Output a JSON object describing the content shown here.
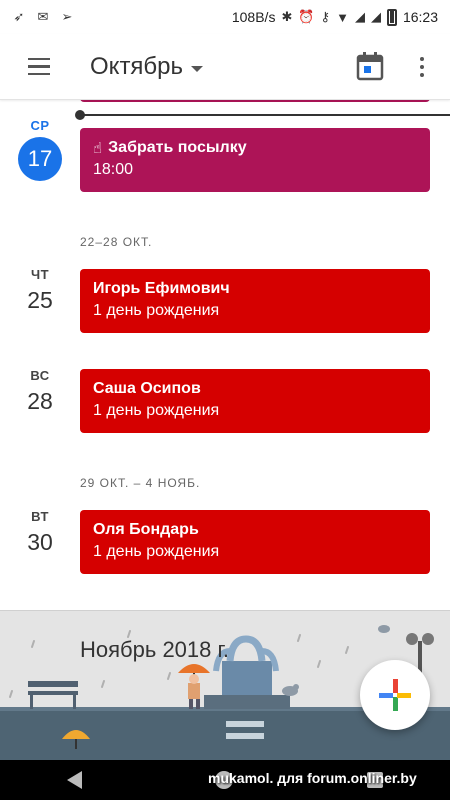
{
  "status_bar": {
    "speed": "108B/s",
    "time": "16:23"
  },
  "app_bar": {
    "month": "Октябрь"
  },
  "schedule": {
    "days": [
      {
        "dow": "СР",
        "num": "17",
        "today": true,
        "event": {
          "title": "Забрать посылку",
          "subtitle": "18:00"
        }
      },
      {
        "dow": "ЧТ",
        "num": "25",
        "event": {
          "title": "Игорь Ефимович",
          "subtitle": "1 день рождения"
        }
      },
      {
        "dow": "ВС",
        "num": "28",
        "event": {
          "title": "Саша Осипов",
          "subtitle": "1 день рождения"
        }
      },
      {
        "dow": "ВТ",
        "num": "30",
        "event": {
          "title": "Оля Бондарь",
          "subtitle": "1 день рождения"
        }
      }
    ],
    "weeks": [
      "22–28 ОКТ.",
      "29 ОКТ. – 4 НОЯБ."
    ]
  },
  "banner": {
    "title": "Ноябрь 2018 г."
  },
  "watermark": "mukamol. для forum.onliner.by",
  "colors": {
    "accent": "#1a73e8",
    "birthday": "#d50000",
    "reminder": "#ad1457"
  },
  "icons": [
    "menu-icon",
    "calendar-today-icon",
    "more-vert-icon",
    "add-icon",
    "hand-pointer-icon"
  ]
}
